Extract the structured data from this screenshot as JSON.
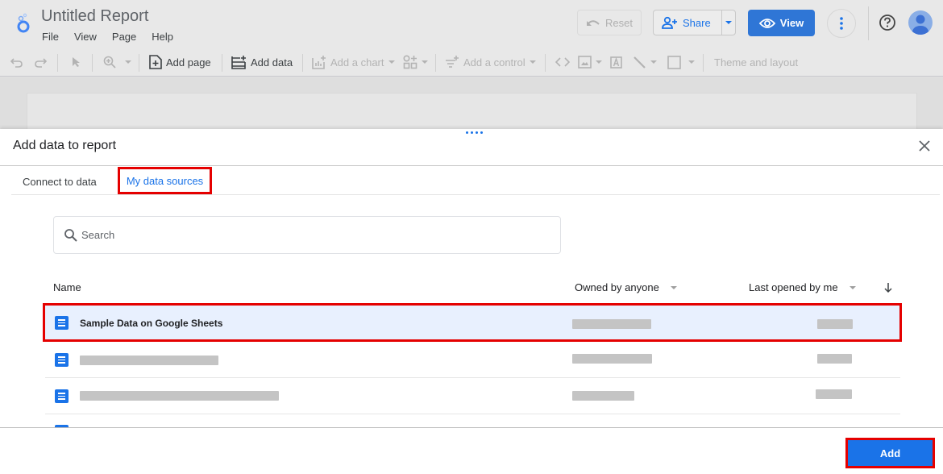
{
  "header": {
    "title": "Untitled Report",
    "menu": [
      "File",
      "View",
      "Page",
      "Help"
    ],
    "reset_label": "Reset",
    "share_label": "Share",
    "view_label": "View"
  },
  "toolbar": {
    "add_page_label": "Add page",
    "add_data_label": "Add data",
    "add_chart_label": "Add a chart",
    "add_control_label": "Add a control",
    "theme_label": "Theme and layout"
  },
  "panel": {
    "title": "Add data to report",
    "tabs": [
      {
        "label": "Connect to data",
        "active": false
      },
      {
        "label": "My data sources",
        "active": true
      }
    ],
    "search_placeholder": "Search",
    "columns": {
      "name": "Name",
      "owner": "Owned by anyone",
      "last_opened": "Last opened by me"
    },
    "rows": [
      {
        "name": "Sample Data on Google Sheets",
        "selected": true,
        "owner": "[redacted]",
        "last_opened": "[redacted]"
      },
      {
        "name": "[redacted]",
        "selected": false,
        "owner": "[redacted]",
        "last_opened": "[redacted]"
      },
      {
        "name": "[redacted]",
        "selected": false,
        "owner": "[redacted]",
        "last_opened": "[redacted]"
      }
    ],
    "add_button_label": "Add"
  },
  "colors": {
    "accent": "#1a73e8",
    "view_button": "#2f76d6",
    "highlight_outline": "#e50000",
    "selected_row_bg": "#e8f0fe"
  }
}
